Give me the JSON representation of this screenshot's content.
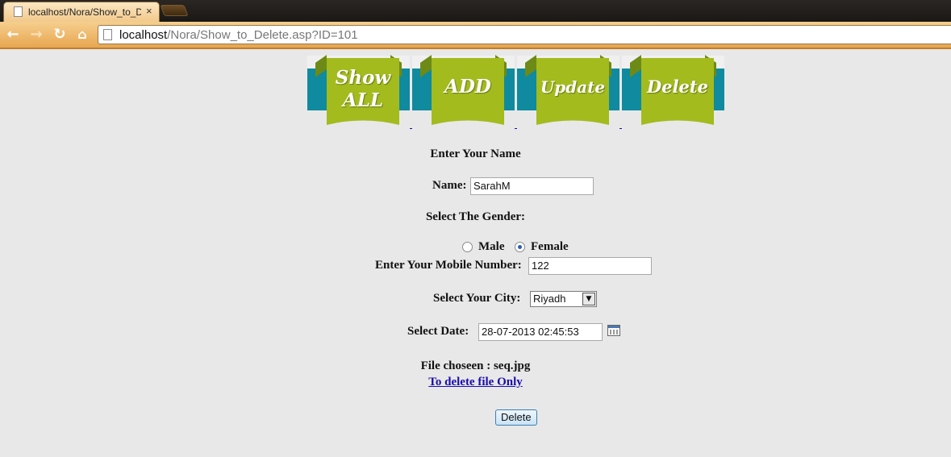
{
  "browser": {
    "tab_title": "localhost/Nora/Show_to_Delete.asp",
    "tab_close": "×",
    "url_host": "localhost",
    "url_path": "/Nora/Show_to_Delete.asp?ID=101"
  },
  "menu": {
    "items": [
      {
        "line1": "Show",
        "line2": "ALL"
      },
      {
        "line1": "ADD"
      },
      {
        "line1": "Update"
      },
      {
        "line1": "Delete"
      }
    ],
    "colors": {
      "ribbon": "#a3bb1d",
      "band": "#0f8a9e"
    }
  },
  "form": {
    "heading": "Enter Your Name",
    "name_label": "Name:",
    "name_value": "SarahM",
    "gender_label": "Select The Gender:",
    "gender_options": [
      "Male",
      "Female"
    ],
    "gender_selected": "Female",
    "mobile_label": "Enter Your Mobile Number:",
    "mobile_value": "122",
    "city_label": "Select Your City:",
    "city_value": "Riyadh",
    "date_label": "Select Date:",
    "date_value": "28-07-2013 02:45:53",
    "file_label": "File choseen : seq.jpg",
    "delete_file_link": "To delete file Only",
    "delete_button": "Delete"
  }
}
